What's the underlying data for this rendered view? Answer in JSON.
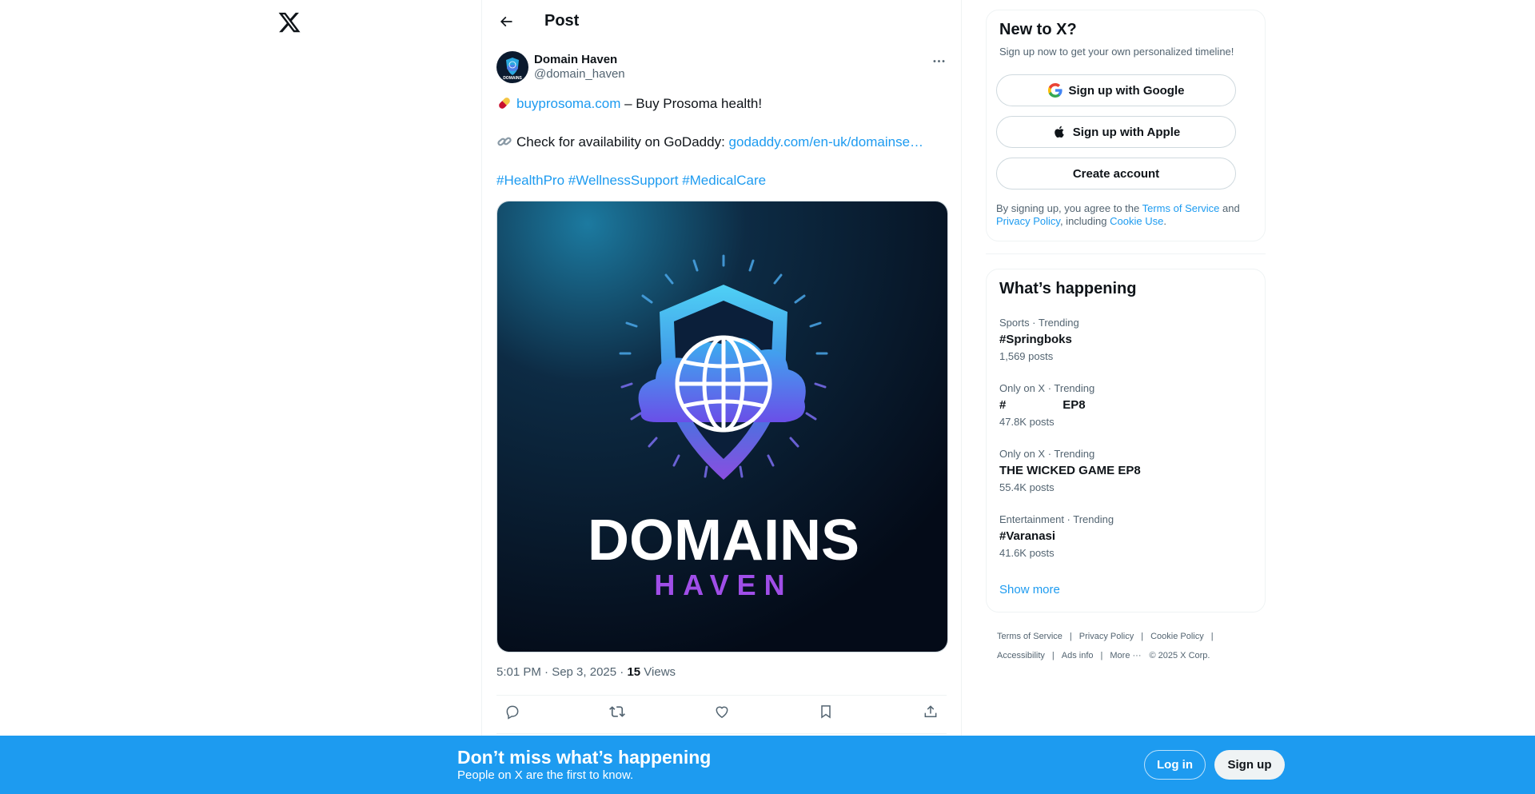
{
  "topbar": {
    "title": "Post"
  },
  "post": {
    "author": {
      "display_name": "Domain Haven",
      "handle": "@domain_haven"
    },
    "line1": {
      "link": "buyprosoma.com",
      "text": " – Buy Prosoma health!"
    },
    "line2": {
      "text": "Check for availability on GoDaddy: ",
      "link": "godaddy.com/en-uk/domainse…"
    },
    "hashtags": [
      "#HealthPro",
      "#WellnessSupport",
      "#MedicalCare"
    ],
    "image": {
      "title": "DOMAINS",
      "subtitle": "HAVEN",
      "avatar_text": "DOMAINS"
    },
    "meta": {
      "time": "5:01 PM · Sep 3, 2025 · ",
      "views_count": "15",
      "views_label": " Views"
    }
  },
  "signup_card": {
    "title": "New to X?",
    "subtitle": "Sign up now to get your own personalized timeline!",
    "google_label": "Sign up with Google",
    "apple_label": "Sign up with Apple",
    "create_label": "Create account",
    "legal": {
      "prefix": "By signing up, you agree to the ",
      "terms": "Terms of Service",
      "and": " and ",
      "privacy": "Privacy Policy",
      "including": ", including ",
      "cookie": "Cookie Use",
      "end": "."
    }
  },
  "trends": {
    "title": "What’s happening",
    "items": [
      {
        "context": "Sports · Trending",
        "name": "#Springboks",
        "count": "1,569 posts"
      },
      {
        "context": "Only on X · Trending",
        "name": "#                 EP8",
        "count": "47.8K posts"
      },
      {
        "context": "Only on X · Trending",
        "name": "THE WICKED GAME EP8",
        "count": "55.4K posts"
      },
      {
        "context": "Entertainment · Trending",
        "name": "#Varanasi",
        "count": "41.6K posts"
      }
    ],
    "show_more": "Show more"
  },
  "footer": {
    "links": [
      "Terms of Service",
      "Privacy Policy",
      "Cookie Policy",
      "Accessibility",
      "Ads info",
      "More ···"
    ],
    "copyright": "© 2025 X Corp."
  },
  "banner": {
    "title": "Don’t miss what’s happening",
    "subtitle": "People on X are the first to know.",
    "login_label": "Log in",
    "signup_label": "Sign up"
  },
  "colors": {
    "accent": "#1d9bf0",
    "text": "#0f1419",
    "muted": "#536471",
    "border": "#eff3f4"
  }
}
